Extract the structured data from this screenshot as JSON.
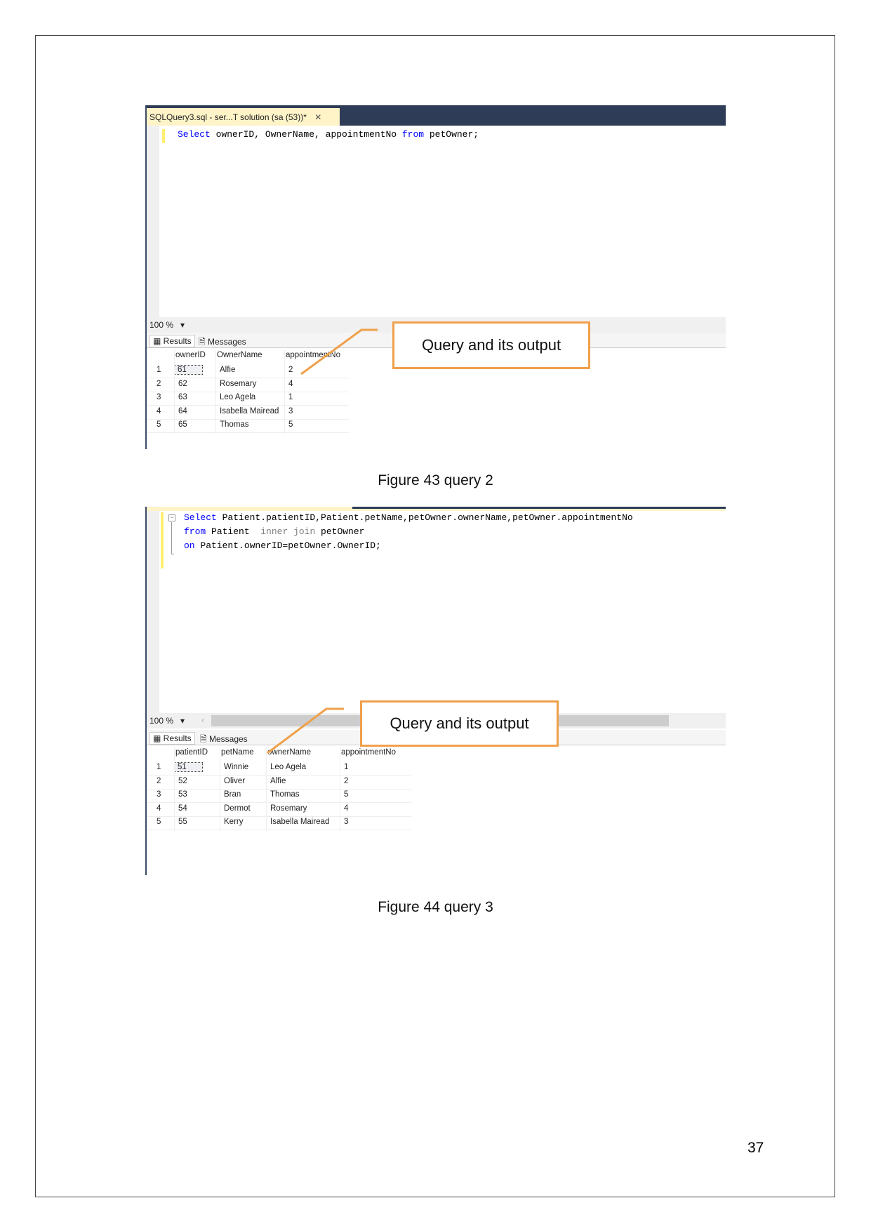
{
  "figure1": {
    "tab_title": "SQLQuery3.sql - ser...T solution (sa (53))*",
    "close_glyph": "✕",
    "code": {
      "kw1": "Select",
      "t1": " ownerID, OwnerName, appointmentNo ",
      "kw2": "from",
      "t2": " petOwner;"
    },
    "zoom": "100 %",
    "results_tab": "Results",
    "messages_tab": "Messages",
    "columns": [
      "ownerID",
      "OwnerName",
      "appointmentNo"
    ],
    "rows": [
      [
        "1",
        "61",
        "Alfie",
        "2"
      ],
      [
        "2",
        "62",
        "Rosemary",
        "4"
      ],
      [
        "3",
        "63",
        "Leo Agela",
        "1"
      ],
      [
        "4",
        "64",
        "Isabella Mairead",
        "3"
      ],
      [
        "5",
        "65",
        "Thomas",
        "5"
      ]
    ],
    "callout": "Query and its output",
    "caption": "Figure 43 query 2"
  },
  "figure2": {
    "code": {
      "l1kw": "Select",
      "l1": " Patient.patientID,Patient.petName,petOwner.ownerName,petOwner.appointmentNo",
      "l2kw": "from",
      "l2a": " Patient  ",
      "l2gr": "inner join",
      "l2b": " petOwner",
      "l3kw": "on",
      "l3": " Patient.ownerID=petOwner.OwnerID;"
    },
    "zoom": "100 %",
    "results_tab": "Results",
    "messages_tab": "Messages",
    "columns": [
      "patientID",
      "petName",
      "ownerName",
      "appointmentNo"
    ],
    "rows": [
      [
        "1",
        "51",
        "Winnie",
        "Leo Agela",
        "1"
      ],
      [
        "2",
        "52",
        "Oliver",
        "Alfie",
        "2"
      ],
      [
        "3",
        "53",
        "Bran",
        "Thomas",
        "5"
      ],
      [
        "4",
        "54",
        "Dermot",
        "Rosemary",
        "4"
      ],
      [
        "5",
        "55",
        "Kerry",
        "Isabella Mairead",
        "3"
      ]
    ],
    "callout": "Query and its output",
    "caption": "Figure 44 query 3"
  },
  "page_number": "37",
  "colors": {
    "callout_border": "#f0a04b",
    "keyword": "#0000ff",
    "tab_bar": "#2e3c57"
  }
}
